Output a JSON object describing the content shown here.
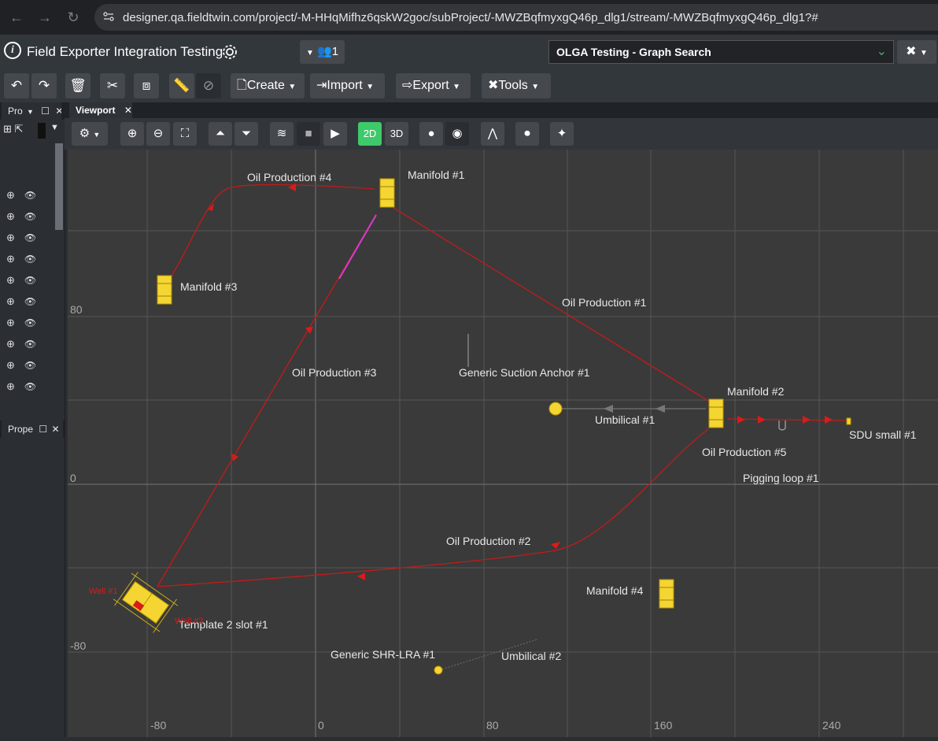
{
  "browser": {
    "url": "designer.qa.fieldtwin.com/project/-M-HHqMifhz6qskW2goc/subProject/-MWZBqfmyxgQ46p_dlg1/stream/-MWZBqfmyxgQ46p_dlg1?#"
  },
  "header": {
    "logo": "i",
    "project_title": "Field Exporter Integration Testing",
    "users_count": "1",
    "scenario_select": "OLGA Testing - Graph Search"
  },
  "toolbar": {
    "create_label": "Create",
    "import_label": "Import",
    "export_label": "Export",
    "tools_label": "Tools"
  },
  "left_panel": {
    "project_tab": "Pro",
    "properties_tab": "Prope",
    "row_count": 10
  },
  "viewport": {
    "tab_label": "Viewport",
    "mode_2d": "2D",
    "mode_3d": "3D",
    "axis_y_labels": [
      "80",
      "0",
      "-80"
    ],
    "axis_x_labels": [
      "-80",
      "0",
      "80",
      "160",
      "240"
    ],
    "labels": {
      "manifold1": "Manifold #1",
      "manifold2": "Manifold #2",
      "manifold3": "Manifold #3",
      "manifold4": "Manifold #4",
      "oil1": "Oil Production #1",
      "oil2": "Oil Production #2",
      "oil3": "Oil Production #3",
      "oil4": "Oil Production #4",
      "oil5": "Oil Production #5",
      "anchor": "Generic Suction Anchor #1",
      "umbilical1": "Umbilical #1",
      "umbilical2": "Umbilical #2",
      "sdu": "SDU small #1",
      "pigging": "Pigging loop #1",
      "template": "Template 2 slot #1",
      "shr": "Generic SHR-LRA #1",
      "well1": "Well #1",
      "well2": "Well #2"
    }
  }
}
